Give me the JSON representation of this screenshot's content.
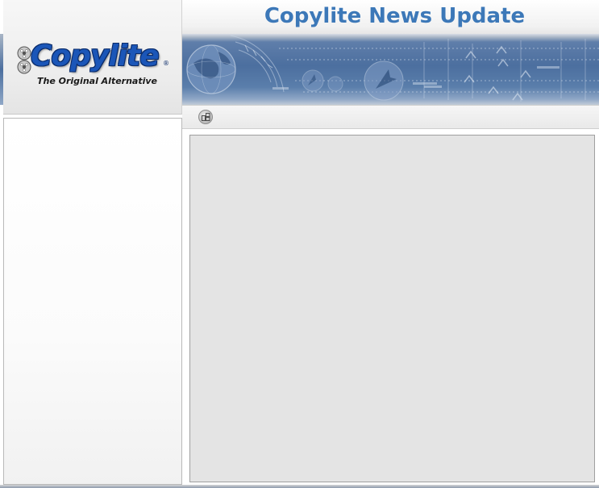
{
  "header": {
    "title": "Copylite News Update"
  },
  "logo": {
    "wordmark": "Copylite",
    "registered_mark": "®",
    "tagline": "The Original Alternative"
  },
  "toolbar": {
    "buttons": [
      {
        "icon": "layout-icon"
      }
    ]
  },
  "colors": {
    "title_text": "#3c78b8",
    "logo_blue": "#1b56b8",
    "banner_blue": "#4c6f9f",
    "content_background": "#e4e4e4"
  }
}
